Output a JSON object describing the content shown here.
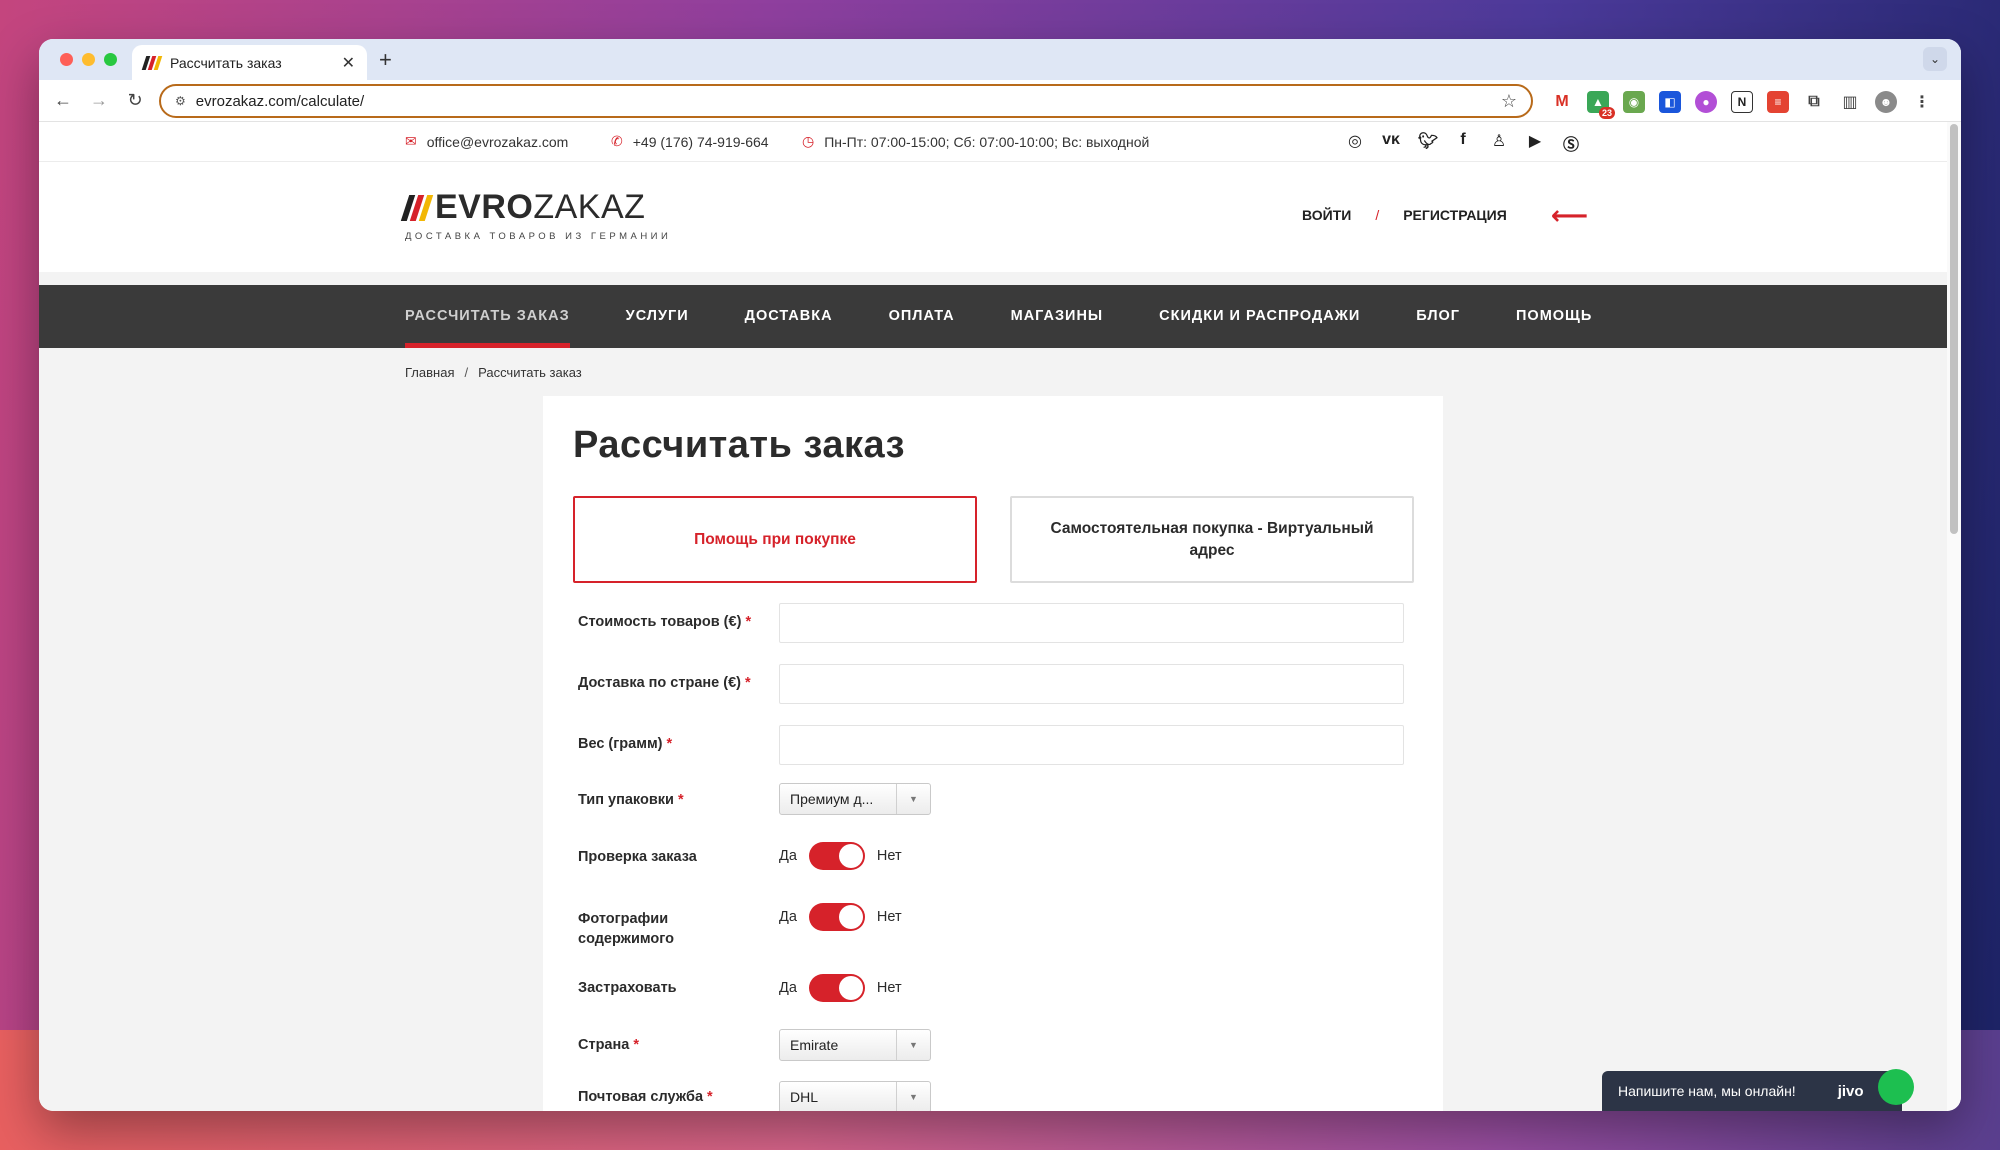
{
  "browser": {
    "tab_title": "Рассчитать заказ",
    "tab_close": "✕",
    "new_tab": "+",
    "tab_menu": "⌄",
    "url": "evrozakaz.com/calculate/",
    "ext_badge": "23"
  },
  "topinfo": {
    "email": "office@evrozakaz.com",
    "phone": "+49 (176) 74-919-664",
    "hours": "Пн-Пт: 07:00-15:00; Сб: 07:00-10:00; Вс: выходной"
  },
  "header": {
    "logo_bold": "EVRO",
    "logo_light": "ZAKAZ",
    "tagline": "ДОСТАВКА ТОВАРОВ ИЗ ГЕРМАНИИ",
    "login": "ВОЙТИ",
    "separator": "/",
    "register": "РЕГИСТРАЦИЯ"
  },
  "nav": [
    "РАССЧИТАТЬ ЗАКАЗ",
    "УСЛУГИ",
    "ДОСТАВКА",
    "ОПЛАТА",
    "МАГАЗИНЫ",
    "СКИДКИ И РАСПРОДАЖИ",
    "БЛОГ",
    "ПОМОЩЬ"
  ],
  "breadcrumb": {
    "home": "Главная",
    "sep": "/",
    "current": "Рассчитать заказ"
  },
  "form": {
    "title": "Рассчитать заказ",
    "option_selected": "Помощь при покупке",
    "option_other": "Самостоятельная покупка - Виртуальный адрес",
    "required_mark": "*",
    "goods_cost": "Стоимость товаров (€)",
    "domestic_delivery": "Доставка по стране (€)",
    "weight": "Вес (грамм)",
    "package_type": "Тип упаковки",
    "package_value": "Премиум д...",
    "check_order": "Проверка заказа",
    "photos_line1": "Фотографии",
    "photos_line2": "содержимого",
    "insure": "Застраховать",
    "yes": "Да",
    "no": "Нет",
    "country": "Страна",
    "country_value": "Emirate",
    "postal_service": "Почтовая служба",
    "postal_value": "DHL"
  },
  "chat": {
    "text": "Напишите нам, мы онлайн!",
    "brand": "jivo"
  },
  "colors": {
    "accent": "#d6222a",
    "nav_bg": "#3a3a3a",
    "page_bg": "#f3f3f3"
  }
}
